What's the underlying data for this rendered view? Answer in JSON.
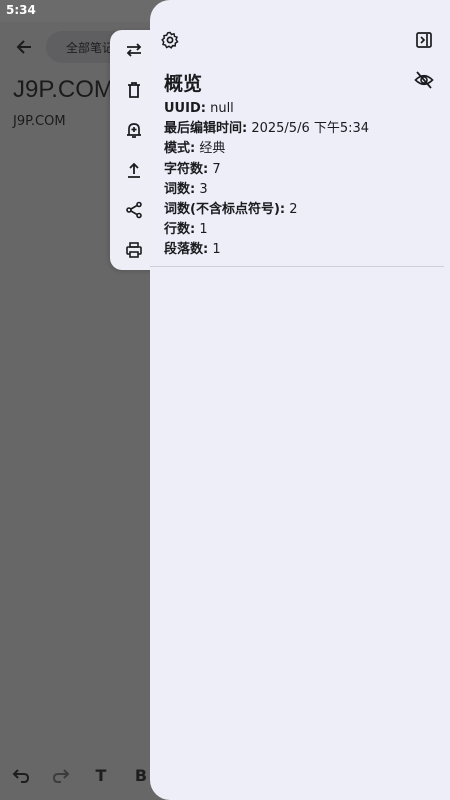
{
  "status_bar": {
    "time": "5:34",
    "icons": [
      "wifi-icon",
      "battery-icon"
    ]
  },
  "editor": {
    "folder_chip": "全部笔记",
    "note_title": "J9P.COM",
    "note_body": "J9P.COM",
    "format_bar": {
      "bold_label": "B",
      "text_label": "T"
    }
  },
  "action_rail": {
    "items": [
      "swap-icon",
      "delete-icon",
      "add-reminder-icon",
      "export-icon",
      "share-icon",
      "print-icon"
    ]
  },
  "panel": {
    "heading": "概览",
    "rows": [
      {
        "key": "UUID:",
        "value": " null"
      },
      {
        "key": "最后编辑时间:",
        "value": " 2025/5/6 下午5:34"
      },
      {
        "key": "模式:",
        "value": " 经典"
      },
      {
        "key": "字符数:",
        "value": " 7"
      },
      {
        "key": "词数:",
        "value": " 3"
      },
      {
        "key": "词数(不含标点符号):",
        "value": " 2"
      },
      {
        "key": "行数:",
        "value": " 1"
      },
      {
        "key": "段落数:",
        "value": " 1"
      }
    ]
  },
  "colors": {
    "panel_bg": "#eeeef8",
    "scrim": "#6b6b6b",
    "text": "#1b1b1f"
  }
}
